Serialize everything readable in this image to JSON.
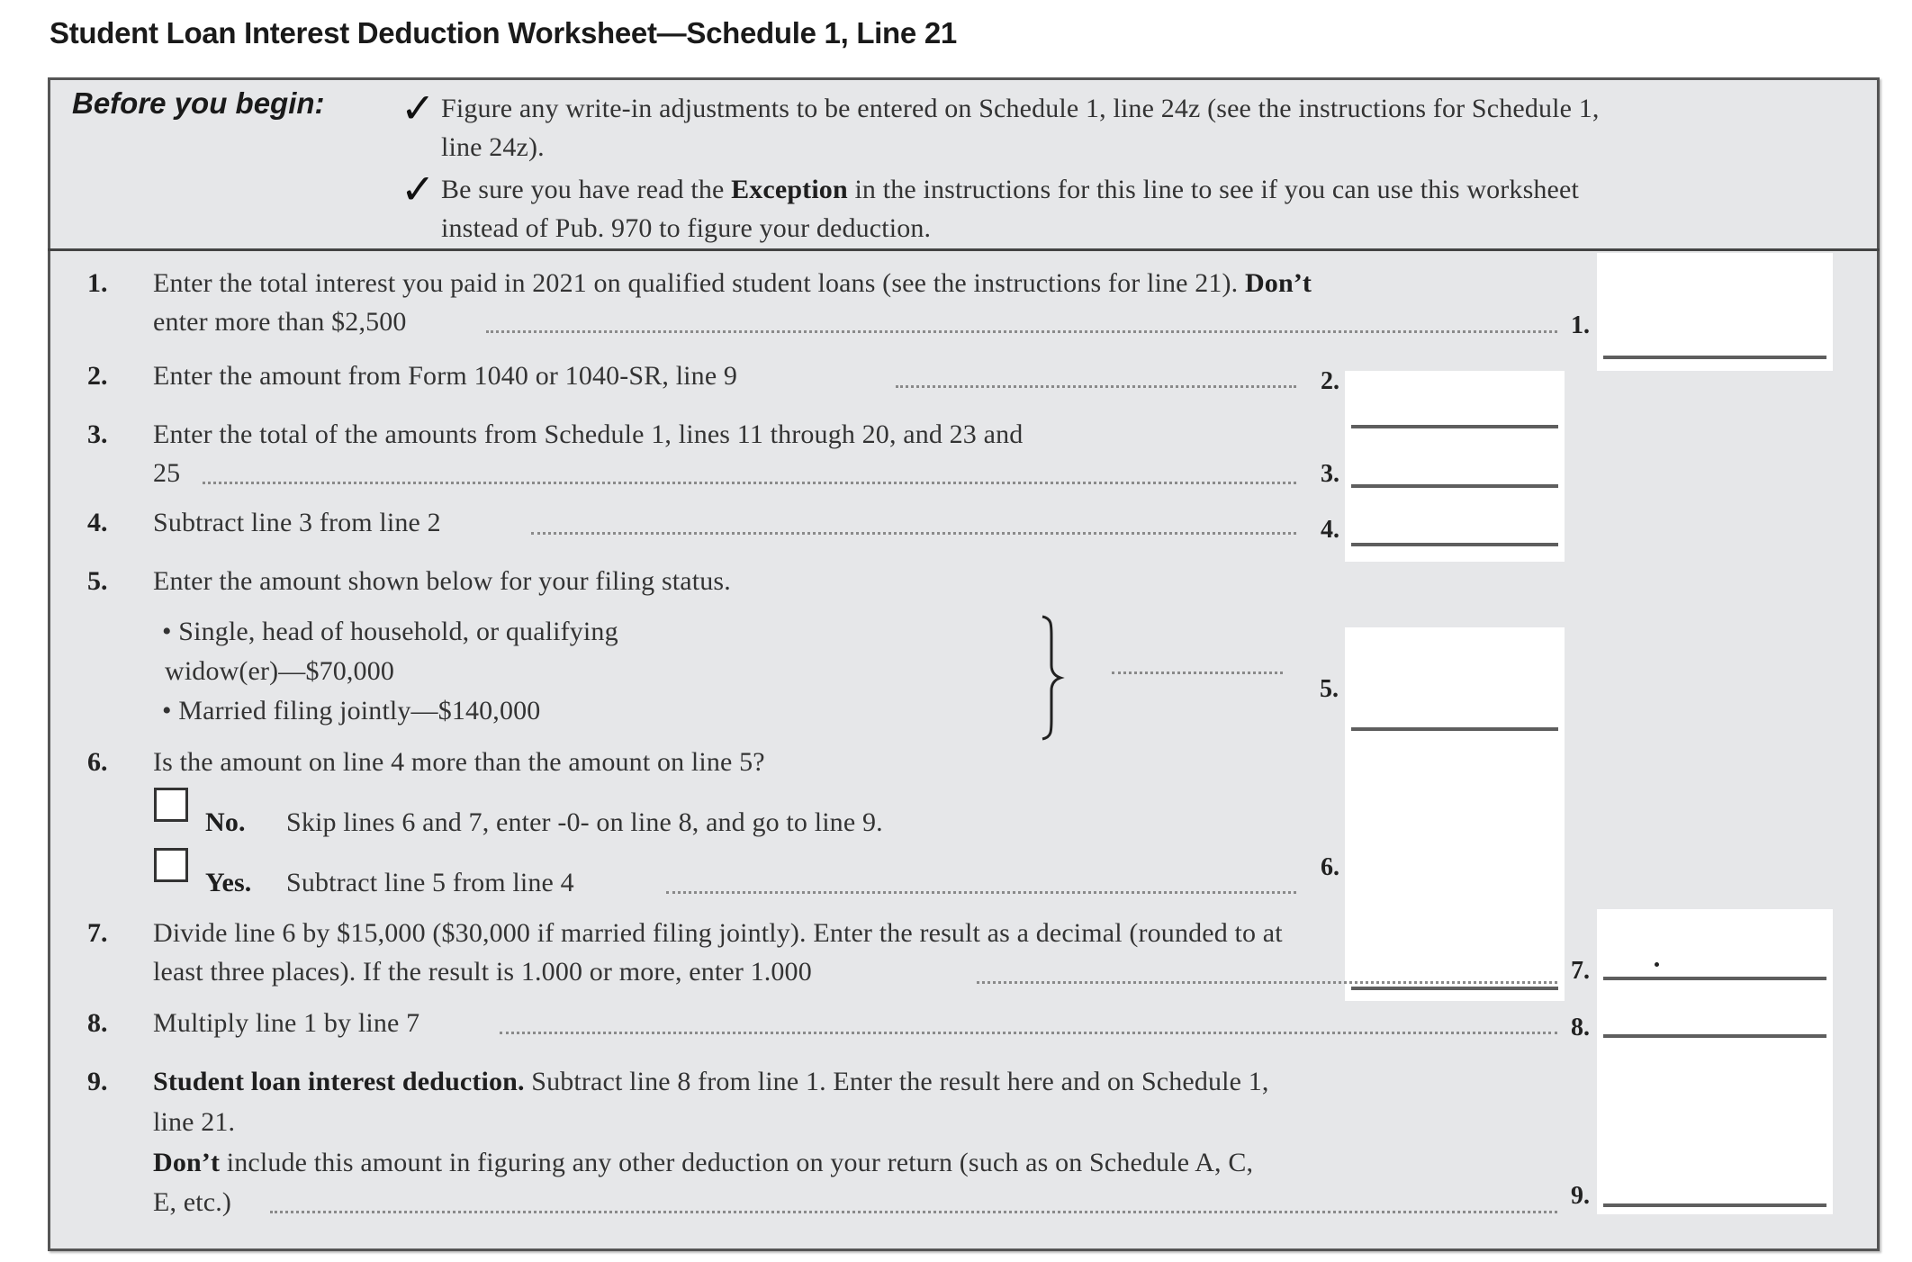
{
  "title": "Student Loan Interest Deduction Worksheet—Schedule 1, Line 21",
  "before_you_begin": {
    "heading": "Before you begin:",
    "items": [
      {
        "icon": "checkmark-icon",
        "line1": "Figure any write-in adjustments to be entered on Schedule 1, line 24z (see the instructions for Schedule 1,",
        "line2": "line 24z)."
      },
      {
        "icon": "checkmark-icon",
        "line1_pre": "Be sure you have read the ",
        "line1_bold": "Exception",
        "line1_post": " in the instructions for this line to see if you can use this worksheet",
        "line2": "instead of Pub. 970 to figure your deduction."
      }
    ]
  },
  "lines": {
    "l1": {
      "num": "1.",
      "text1_pre": "Enter the total interest you paid in 2021 on qualified student loans (see the instructions for line 21). ",
      "text1_bold": "Don’t",
      "text2": "enter more than $2,500",
      "label": "1.",
      "value": ""
    },
    "l2": {
      "num": "2.",
      "text": "Enter the amount from Form 1040 or 1040-SR, line 9",
      "label": "2.",
      "value": ""
    },
    "l3": {
      "num": "3.",
      "text1": "Enter the total of the amounts from Schedule 1, lines 11 through 20, and 23 and",
      "text2": "25",
      "label": "3.",
      "value": ""
    },
    "l4": {
      "num": "4.",
      "text": "Subtract line 3 from line 2",
      "label": "4.",
      "value": ""
    },
    "l5": {
      "num": "5.",
      "text": "Enter the amount shown below for your filing status.",
      "bullet1_line1": "•  Single, head of household, or qualifying",
      "bullet1_line2": "widow(er)—$70,000",
      "bullet2": "•  Married filing jointly—$140,000",
      "label": "5.",
      "value": ""
    },
    "l6": {
      "num": "6.",
      "text": "Is the amount on line 4 more than the amount on line 5?",
      "no_label": "No.",
      "no_text": "Skip lines 6 and 7, enter -0- on line 8, and go to line 9.",
      "no_checked": false,
      "yes_label": "Yes.",
      "yes_text": "Subtract line 5 from line 4",
      "yes_checked": false,
      "label": "6.",
      "value": ""
    },
    "l7": {
      "num": "7.",
      "text1": "Divide line 6 by $15,000 ($30,000 if married filing jointly). Enter the result as a decimal (rounded to at",
      "text2": "least three places). If the result is 1.000 or more, enter 1.000",
      "label": "7.",
      "value": "",
      "decimal_mark": "."
    },
    "l8": {
      "num": "8.",
      "text": "Multiply line 1 by line 7",
      "label": "8.",
      "value": ""
    },
    "l9": {
      "num": "9.",
      "text1_bold": "Student loan interest deduction.",
      "text1_post": " Subtract line 8 from line 1. Enter the result here and on Schedule 1,",
      "text2": "line 21.",
      "text3_bold": "Don’t",
      "text3_post": " include this amount in figuring any other deduction on your return (such as on Schedule A, C,",
      "text4": "E, etc.)",
      "label": "9.",
      "value": ""
    }
  }
}
